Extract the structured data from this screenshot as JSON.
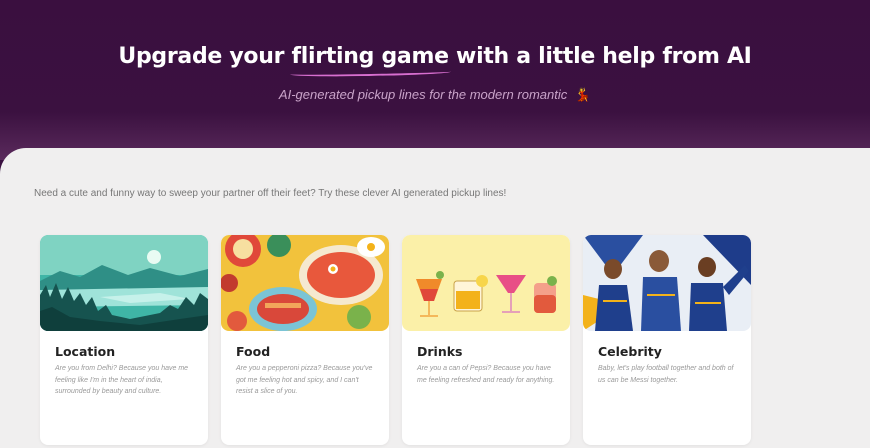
{
  "hero": {
    "title_before": "Upgrade your ",
    "title_highlight": "flirting game",
    "title_after": " with a little help from AI",
    "subtitle": "AI-generated pickup lines for the modern romantic",
    "subtitle_emoji": "💃"
  },
  "main": {
    "intro": "Need a cute and funny way to sweep your partner off their feet? Try these clever AI generated pickup lines!",
    "cards": [
      {
        "title": "Location",
        "text": "Are you from Delhi? Because you have me feeling like I'm in the heart of india, surrounded by beauty and culture.",
        "image": "landscape-lake-image"
      },
      {
        "title": "Food",
        "text": "Are you a pepperoni pizza? Because you've got me feeling hot and spicy, and I can't resist a slice of you.",
        "image": "food-platter-image"
      },
      {
        "title": "Drinks",
        "text": "Are you a can of Pepsi? Because you have me feeling refreshed and ready for anything.",
        "image": "cocktails-image"
      },
      {
        "title": "Celebrity",
        "text": "Baby, let's play football together and both of us can be Messi together.",
        "image": "football-players-image"
      }
    ]
  },
  "colors": {
    "hero_bg": "#3a0f3f",
    "highlight_underline": "#d86fd0",
    "panel_bg": "#f0efef"
  }
}
